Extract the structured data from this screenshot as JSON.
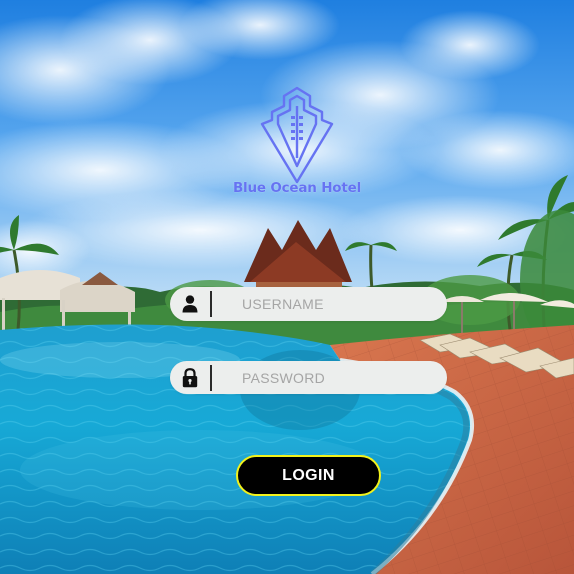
{
  "brand": {
    "name": "Blue Ocean Hotel",
    "logo_icon": "hotel-building-icon",
    "color": "#6673f2"
  },
  "login_form": {
    "username": {
      "icon": "user-icon",
      "placeholder": "USERNAME",
      "value": ""
    },
    "password": {
      "icon": "lock-icon",
      "placeholder": "PASSWORD",
      "value": ""
    },
    "submit_label": "LOGIN"
  },
  "colors": {
    "button_bg": "#000000",
    "button_border": "#f2f21c",
    "field_bg": "#eceeed",
    "placeholder": "#a5a5a5"
  }
}
